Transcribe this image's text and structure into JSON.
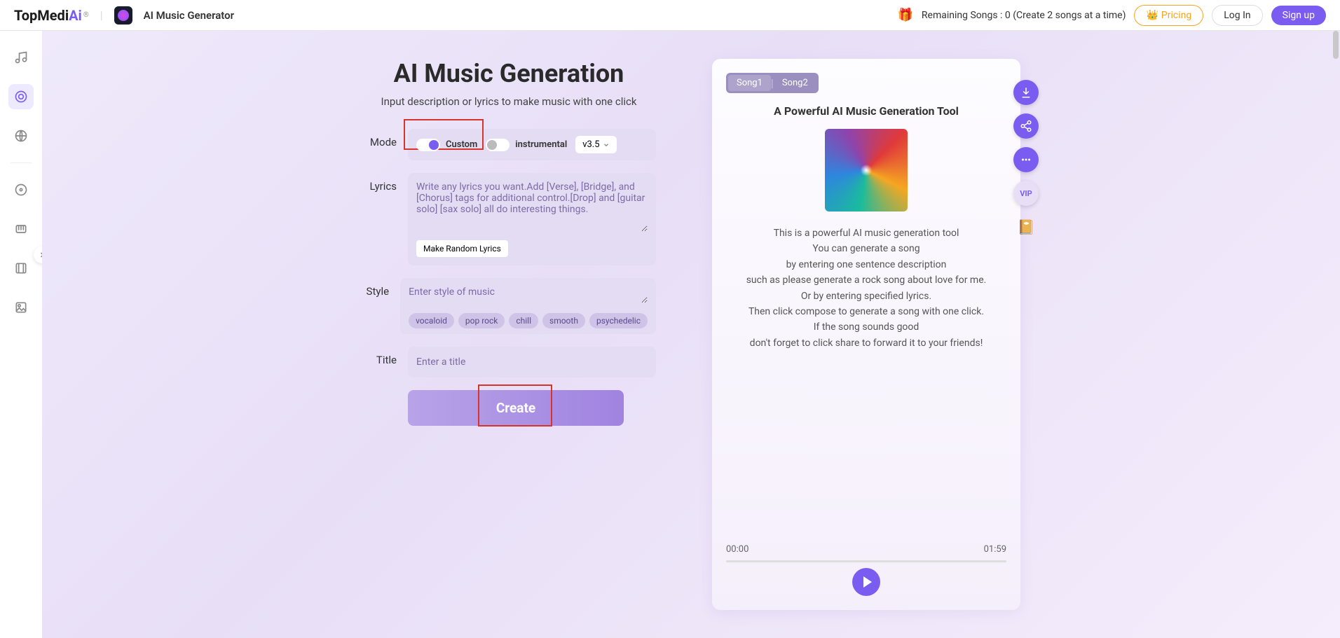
{
  "header": {
    "logo_main": "TopMedi",
    "logo_ai": "Ai",
    "logo_reg": "®",
    "app_name": "AI Music Generator",
    "remaining_label": "Remaining Songs :",
    "remaining_count": "0",
    "remaining_note": "(Create 2 songs at a time)",
    "pricing": "Pricing",
    "login": "Log In",
    "signup": "Sign up"
  },
  "form": {
    "title": "AI Music Generation",
    "subtitle": "Input description or lyrics to make music with one click",
    "mode_label": "Mode",
    "custom_label": "Custom",
    "instrumental_label": "instrumental",
    "version": "v3.5",
    "lyrics_label": "Lyrics",
    "lyrics_placeholder": "Write any lyrics you want.Add [Verse], [Bridge], and [Chorus] tags for additional control.[Drop] and [guitar solo] [sax solo] all do interesting things.",
    "make_random": "Make Random Lyrics",
    "style_label": "Style",
    "style_placeholder": "Enter style of music",
    "tags": [
      "vocaloid",
      "pop rock",
      "chill",
      "smooth",
      "psychedelic"
    ],
    "title_label": "Title",
    "title_placeholder": "Enter a title",
    "create": "Create"
  },
  "preview": {
    "song1": "Song1",
    "song2": "Song2",
    "title": "A Powerful AI Music Generation Tool",
    "desc_lines": [
      "This is a powerful AI music generation tool",
      "You can generate a song",
      "by entering one sentence description",
      "such as please generate a rock song about love for me.",
      "Or by entering specified lyrics.",
      "Then click compose to generate a song with one click.",
      "If the song sounds good",
      "don't forget to click share to forward it to your friends!"
    ],
    "vip": "VIP",
    "time_start": "00:00",
    "time_end": "01:59"
  }
}
